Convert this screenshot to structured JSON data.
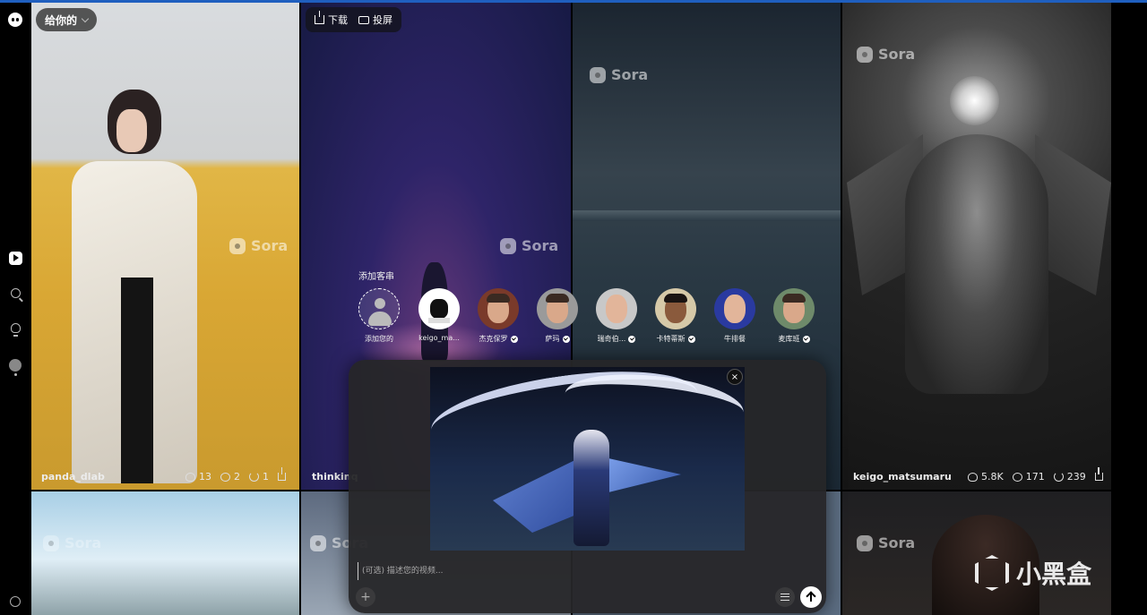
{
  "nav": {
    "feed_filter": "给你的",
    "toolbar": {
      "download": "下载",
      "cast": "投屏"
    }
  },
  "rail_icons": [
    "logo-icon",
    "play-icon",
    "search-icon",
    "bulb-icon",
    "profile-icon",
    "smile-icon"
  ],
  "tiles": [
    {
      "username": "panda_dlab",
      "likes": "13",
      "comments": "2",
      "remixes": "1",
      "watermark": "Sora"
    },
    {
      "username": "thinkinq",
      "watermark": "Sora"
    },
    {
      "watermark": "Sora"
    },
    {
      "username": "keigo_matsumaru",
      "likes": "5.8K",
      "comments": "171",
      "remixes": "239",
      "watermark": "Sora"
    }
  ],
  "bottom_watermarks": [
    "Sora",
    "Sora",
    "Sora"
  ],
  "cameos": {
    "title": "添加客串",
    "items": [
      {
        "label": "添加您的",
        "verified": false
      },
      {
        "label": "keigo_ma...",
        "verified": false
      },
      {
        "label": "杰克保罗",
        "verified": true
      },
      {
        "label": "萨玛",
        "verified": true
      },
      {
        "label": "瑞奇伯...",
        "verified": true
      },
      {
        "label": "卡特蒂斯",
        "verified": true
      },
      {
        "label": "牛排餐",
        "verified": false
      },
      {
        "label": "麦库班",
        "verified": true
      }
    ]
  },
  "composer": {
    "placeholder": "(可选) 描述您的视频...",
    "close": "×",
    "plus": "+"
  },
  "site_watermark": "小黑盒",
  "colors": {
    "accent": "#1f5fbf",
    "panel": "#262628"
  }
}
